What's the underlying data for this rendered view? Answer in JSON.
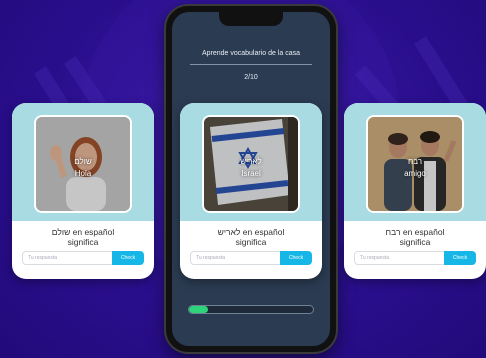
{
  "phone": {
    "title": "Aprende vocabulario de la casa",
    "counter": "2/10",
    "progress": 0.15,
    "progress_color": "#2ed47a",
    "screen_color": "#2b3b52"
  },
  "cards": [
    {
      "word": "שולם",
      "translation": "Hola",
      "question_line1": "שולם en español",
      "question_line2": "significa",
      "placeholder": "Tu respuesta",
      "check_label": "Check",
      "photo": "woman-waving"
    },
    {
      "word": "לאריש",
      "translation": "Israel",
      "question_line1": "לאריש en español",
      "question_line2": "significa",
      "placeholder": "Tu respuesta",
      "check_label": "Check",
      "photo": "israel-flag"
    },
    {
      "word": "רבח",
      "translation": "amigo",
      "question_line1": "רבח en español",
      "question_line2": "significa",
      "placeholder": "Tu respuesta",
      "check_label": "Check",
      "photo": "two-friends"
    }
  ],
  "colors": {
    "background": "#2a0f8e",
    "card_band": "#a9dbe2",
    "check_button": "#16b7e6"
  }
}
